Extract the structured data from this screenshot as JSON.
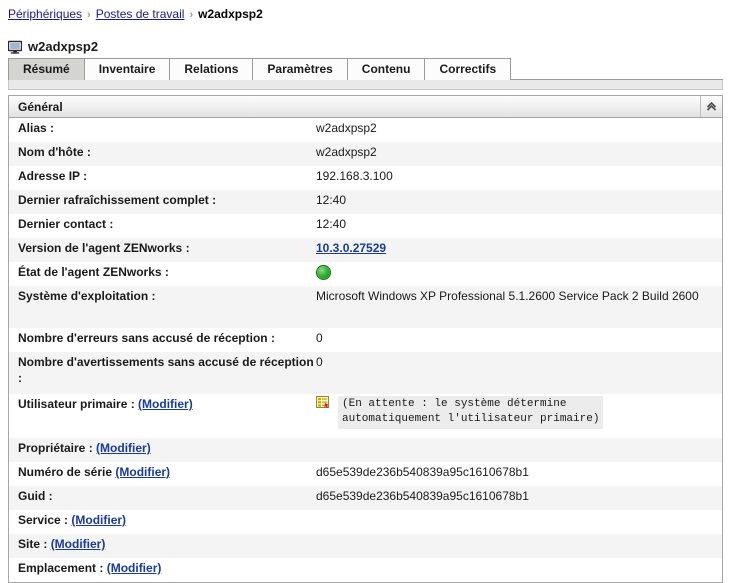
{
  "breadcrumb": {
    "items": [
      {
        "label": "Périphériques",
        "link": true
      },
      {
        "label": "Postes de travail",
        "link": true
      },
      {
        "label": "w2adxpsp2",
        "link": false
      }
    ],
    "separator": "›"
  },
  "page": {
    "title": "w2adxpsp2",
    "icon": "workstation-monitor-icon"
  },
  "tabs": [
    {
      "label": "Résumé",
      "active": true
    },
    {
      "label": "Inventaire",
      "active": false
    },
    {
      "label": "Relations",
      "active": false
    },
    {
      "label": "Paramètres",
      "active": false
    },
    {
      "label": "Contenu",
      "active": false
    },
    {
      "label": "Correctifs",
      "active": false
    }
  ],
  "panel": {
    "title": "Général",
    "collapse_icon": "chevron-double-up-icon",
    "rows": [
      {
        "label": "Alias :",
        "value": "w2adxpsp2"
      },
      {
        "label": "Nom d'hôte :",
        "value": "w2adxpsp2"
      },
      {
        "label": "Adresse IP :",
        "value": "192.168.3.100"
      },
      {
        "label": "Dernier rafraîchissement complet :",
        "value": "12:40"
      },
      {
        "label": "Dernier contact :",
        "value": "12:40"
      },
      {
        "label": "Version de l'agent ZENworks :",
        "value": "10.3.0.27529"
      },
      {
        "label": "État de l'agent ZENworks :",
        "value": ""
      },
      {
        "label": "Système d'exploitation :",
        "value": "Microsoft Windows XP Professional 5.1.2600 Service Pack 2 Build 2600"
      },
      {
        "label": "Nombre d'erreurs sans accusé de réception :",
        "value": "0"
      },
      {
        "label": "Nombre d'avertissements sans accusé de réception :",
        "value": "0"
      },
      {
        "label": "Utilisateur primaire :",
        "value": "(En attente : le système détermine\nautomatiquement l'utilisateur primaire)"
      },
      {
        "label": "Propriétaire :",
        "value": ""
      },
      {
        "label": "Numéro de série",
        "value": "d65e539de236b540839a95c1610678b1"
      },
      {
        "label": "Guid :",
        "value": "d65e539de236b540839a95c1610678b1"
      },
      {
        "label": "Service :",
        "value": ""
      },
      {
        "label": "Site :",
        "value": ""
      },
      {
        "label": "Emplacement :",
        "value": ""
      }
    ],
    "edit_link": "(Modifier)"
  },
  "colors": {
    "link": "#1a3a99",
    "breadcrumb_link": "#1a1a8c",
    "status_ok": "#33b233",
    "row_alt_bg": "#f4f4f4",
    "panel_border": "#a6a6a6",
    "active_tab_bg": "#d4d4d0"
  }
}
